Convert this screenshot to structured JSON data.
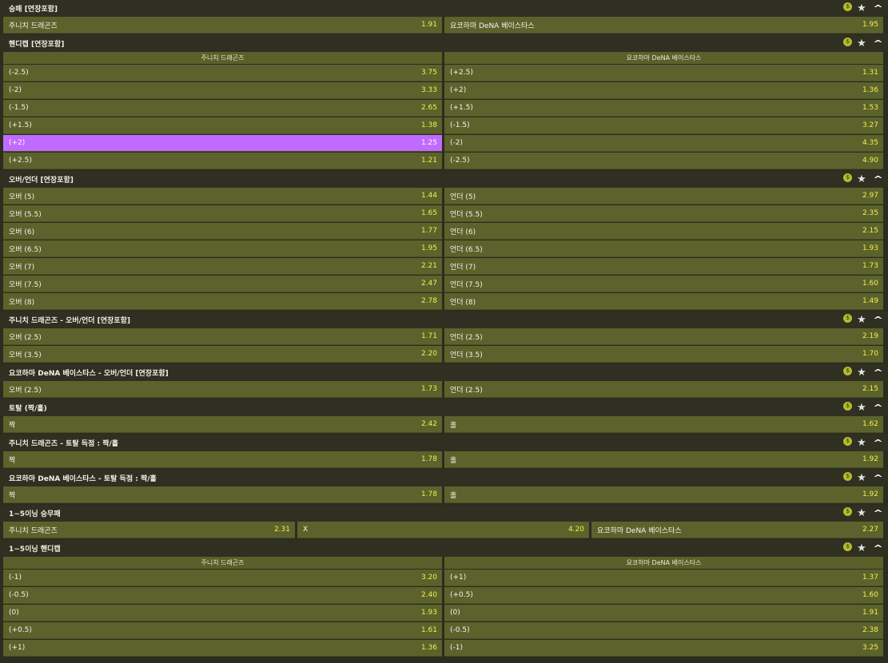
{
  "markets": [
    {
      "title": "승패 [연장포함]",
      "cols": 2,
      "rows": [
        [
          {
            "label": "주니치 드래곤즈",
            "odd": "1.91"
          },
          {
            "label": "요코하마 DeNA 베이스타스",
            "odd": "1.95"
          }
        ]
      ]
    },
    {
      "title": "핸디캡 [연장포함]",
      "cols": 2,
      "headers": [
        "주니치 드래곤즈",
        "요코하마 DeNA 베이스타스"
      ],
      "rows": [
        [
          {
            "label": "(-2.5)",
            "odd": "3.75"
          },
          {
            "label": "(+2.5)",
            "odd": "1.31"
          }
        ],
        [
          {
            "label": "(-2)",
            "odd": "3.33"
          },
          {
            "label": "(+2)",
            "odd": "1.36"
          }
        ],
        [
          {
            "label": "(-1.5)",
            "odd": "2.65"
          },
          {
            "label": "(+1.5)",
            "odd": "1.53"
          }
        ],
        [
          {
            "label": "(+1.5)",
            "odd": "1.38"
          },
          {
            "label": "(-1.5)",
            "odd": "3.27"
          }
        ],
        [
          {
            "label": "(+2)",
            "odd": "1.25",
            "selected": true
          },
          {
            "label": "(-2)",
            "odd": "4.35"
          }
        ],
        [
          {
            "label": "(+2.5)",
            "odd": "1.21"
          },
          {
            "label": "(-2.5)",
            "odd": "4.90"
          }
        ]
      ]
    },
    {
      "title": "오버/언더 [연장포함]",
      "cols": 2,
      "rows": [
        [
          {
            "label": "오버 (5)",
            "odd": "1.44"
          },
          {
            "label": "언더 (5)",
            "odd": "2.97"
          }
        ],
        [
          {
            "label": "오버 (5.5)",
            "odd": "1.65"
          },
          {
            "label": "언더 (5.5)",
            "odd": "2.35"
          }
        ],
        [
          {
            "label": "오버 (6)",
            "odd": "1.77"
          },
          {
            "label": "언더 (6)",
            "odd": "2.15"
          }
        ],
        [
          {
            "label": "오버 (6.5)",
            "odd": "1.95"
          },
          {
            "label": "언더 (6.5)",
            "odd": "1.93"
          }
        ],
        [
          {
            "label": "오버 (7)",
            "odd": "2.21"
          },
          {
            "label": "언더 (7)",
            "odd": "1.73"
          }
        ],
        [
          {
            "label": "오버 (7.5)",
            "odd": "2.47"
          },
          {
            "label": "언더 (7.5)",
            "odd": "1.60"
          }
        ],
        [
          {
            "label": "오버 (8)",
            "odd": "2.78"
          },
          {
            "label": "언더 (8)",
            "odd": "1.49"
          }
        ]
      ]
    },
    {
      "title": "주니치 드래곤즈 - 오버/언더 [연장포함]",
      "cols": 2,
      "rows": [
        [
          {
            "label": "오버 (2.5)",
            "odd": "1.71"
          },
          {
            "label": "언더 (2.5)",
            "odd": "2.19"
          }
        ],
        [
          {
            "label": "오버 (3.5)",
            "odd": "2.20"
          },
          {
            "label": "언더 (3.5)",
            "odd": "1.70"
          }
        ]
      ]
    },
    {
      "title": "요코하마 DeNA 베이스타스 - 오버/언더 [연장포함]",
      "cols": 2,
      "rows": [
        [
          {
            "label": "오버 (2.5)",
            "odd": "1.73"
          },
          {
            "label": "언더 (2.5)",
            "odd": "2.15"
          }
        ]
      ]
    },
    {
      "title": "토탈 (짝/홀)",
      "cols": 2,
      "rows": [
        [
          {
            "label": "짝",
            "odd": "2.42"
          },
          {
            "label": "홀",
            "odd": "1.62"
          }
        ]
      ]
    },
    {
      "title": "주니치 드래곤즈 - 토탈 득점 : 짝/홀",
      "cols": 2,
      "rows": [
        [
          {
            "label": "짝",
            "odd": "1.78"
          },
          {
            "label": "홀",
            "odd": "1.92"
          }
        ]
      ]
    },
    {
      "title": "요코하마 DeNA 베이스타스 - 토탈 득점 : 짝/홀",
      "cols": 2,
      "rows": [
        [
          {
            "label": "짝",
            "odd": "1.78"
          },
          {
            "label": "홀",
            "odd": "1.92"
          }
        ]
      ]
    },
    {
      "title": "1~5이닝 승무패",
      "cols": 3,
      "rows": [
        [
          {
            "label": "주니치 드래곤즈",
            "odd": "2.31"
          },
          {
            "label": "X",
            "odd": "4.20"
          },
          {
            "label": "요코하마 DeNA 베이스타스",
            "odd": "2.27"
          }
        ]
      ]
    },
    {
      "title": "1~5이닝 핸디캡",
      "cols": 2,
      "headers": [
        "주니치 드래곤즈",
        "요코하마 DeNA 베이스타스"
      ],
      "rows": [
        [
          {
            "label": "(-1)",
            "odd": "3.20"
          },
          {
            "label": "(+1)",
            "odd": "1.37"
          }
        ],
        [
          {
            "label": "(-0.5)",
            "odd": "2.40"
          },
          {
            "label": "(+0.5)",
            "odd": "1.60"
          }
        ],
        [
          {
            "label": "(0)",
            "odd": "1.93"
          },
          {
            "label": "(0)",
            "odd": "1.91"
          }
        ],
        [
          {
            "label": "(+0.5)",
            "odd": "1.61"
          },
          {
            "label": "(-0.5)",
            "odd": "2.38"
          }
        ],
        [
          {
            "label": "(+1)",
            "odd": "1.36"
          },
          {
            "label": "(-1)",
            "odd": "3.25"
          }
        ]
      ]
    }
  ],
  "icons": {
    "coin": "coin-icon",
    "star": "star-icon",
    "collapse": "chevron-up-icon"
  },
  "icon_glyphs": {
    "coin": "$",
    "star": "★",
    "collapse": "^"
  },
  "colors": {
    "selected": "#c06bff",
    "odds": "#f1f04a",
    "cell": "#5c622c"
  }
}
